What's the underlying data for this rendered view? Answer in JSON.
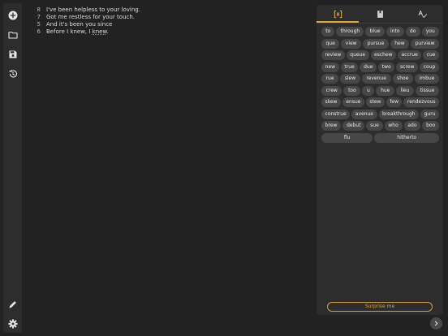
{
  "sidebar": {
    "items": [
      {
        "name": "add-icon",
        "icon": "add-circle"
      },
      {
        "name": "folder-icon",
        "icon": "folder"
      },
      {
        "name": "save-icon",
        "icon": "floppy-disk"
      },
      {
        "name": "history-icon",
        "icon": "history-clock"
      }
    ],
    "bottom_items": [
      {
        "name": "pencil-icon",
        "icon": "pencil"
      },
      {
        "name": "settings-icon",
        "icon": "gear"
      }
    ]
  },
  "lyrics": {
    "lines": [
      {
        "num": "8",
        "text": "I've been helpless to your loving."
      },
      {
        "num": "7",
        "text": "Got me restless for your touch."
      },
      {
        "num": "5",
        "text": "And it's been you since"
      },
      {
        "num": "6",
        "text_before": "Before I knew, I ",
        "highlight": "knew",
        "text_after": "."
      }
    ]
  },
  "panel": {
    "tabs": [
      {
        "name": "rhymes-tab",
        "icon": "rhyme-brackets",
        "active": true
      },
      {
        "name": "dictionary-tab",
        "icon": "book"
      },
      {
        "name": "spellcheck-tab",
        "icon": "spellcheck"
      }
    ],
    "rhymes": [
      "to",
      "through",
      "blue",
      "into",
      "do",
      "you",
      "que",
      "view",
      "pursue",
      "hew",
      "purview",
      "review",
      "queue",
      "eschew",
      "accrue",
      "cue",
      "new",
      "true",
      "due",
      "two",
      "screw",
      "coup",
      "rue",
      "slew",
      "revenue",
      "shoe",
      "imbue",
      "crew",
      "too",
      "u",
      "hue",
      "lieu",
      "tissue",
      "skew",
      "ensue",
      "stew",
      "few",
      "rendezvous",
      "construe",
      "avenue",
      "breakthrough",
      "guru",
      "brew",
      "debut",
      "sue",
      "who",
      "ado",
      "boo",
      "flu",
      "hitherto"
    ],
    "surprise_label": "Surprise me"
  },
  "next_button": {
    "icon": "chevron-right"
  },
  "colors": {
    "background": "#222222",
    "surface": "#2d2d2d",
    "chip": "#474747",
    "accent": "#e0a536"
  }
}
